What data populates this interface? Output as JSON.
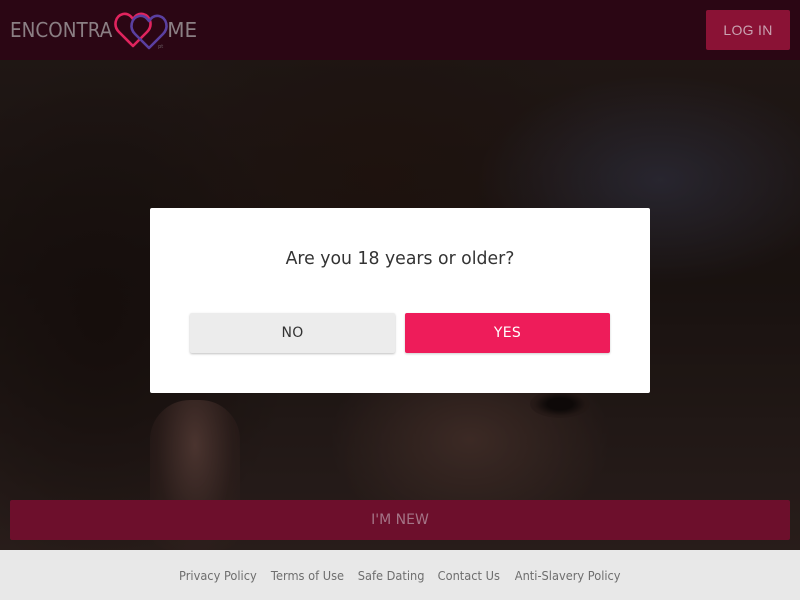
{
  "header": {
    "logo": {
      "word_left": "ENCONTRA",
      "word_right": "ME",
      "sub": "pt",
      "icon": "double-heart-logo-icon",
      "heart_colors": [
        "#e0245e",
        "#5a3fa0"
      ]
    },
    "login_label": "LOG IN"
  },
  "modal": {
    "question": "Are you 18 years or older?",
    "no_label": "NO",
    "yes_label": "YES"
  },
  "main": {
    "new_label": "I'M NEW"
  },
  "footer": {
    "links": [
      "Privacy Policy",
      "Terms of Use",
      "Safe Dating",
      "Contact Us",
      "Anti-Slavery Policy"
    ]
  },
  "colors": {
    "header_bg": "#2b0614",
    "login_bg": "#8a1235",
    "yes_bg": "#ee1c5a",
    "no_bg": "#ececec",
    "new_bg": "#6d0f2c",
    "footer_bg": "#f2f2f2"
  }
}
